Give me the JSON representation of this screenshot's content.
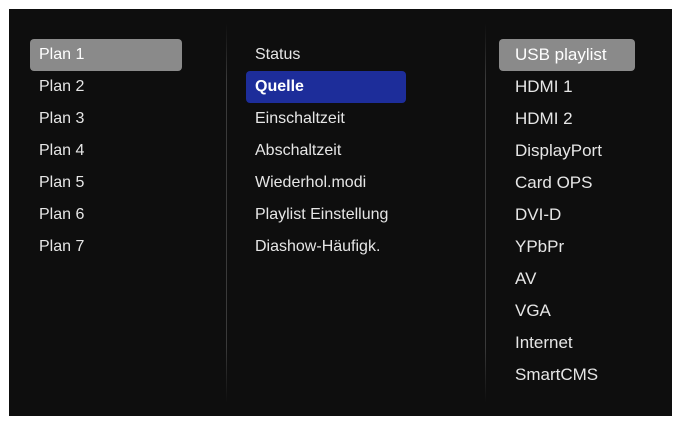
{
  "plans": [
    "Plan 1",
    "Plan 2",
    "Plan 3",
    "Plan 4",
    "Plan 5",
    "Plan 6",
    "Plan 7"
  ],
  "settings": [
    "Status",
    "Quelle",
    "Einschaltzeit",
    "Abschaltzeit",
    "Wiederhol.modi",
    "Playlist Einstellung",
    "Diashow-Häufigk."
  ],
  "sources": [
    "USB playlist",
    "HDMI 1",
    "HDMI 2",
    "DisplayPort",
    "Card OPS",
    "DVI-D",
    "YPbPr",
    "AV",
    "VGA",
    "Internet",
    "SmartCMS"
  ],
  "colors": {
    "background": "#0e0e0e",
    "text": "#e6e6e6",
    "selected_gray": "#8a8a8a",
    "selected_blue": "#1d2d9a"
  }
}
